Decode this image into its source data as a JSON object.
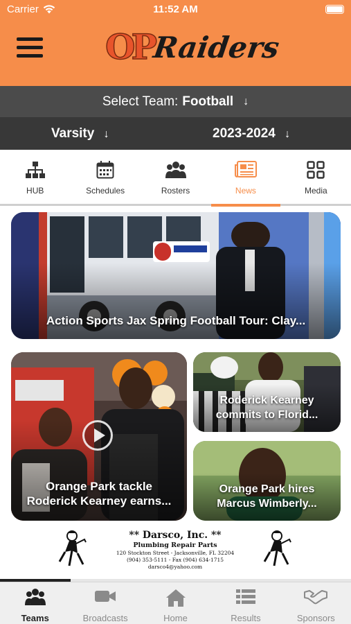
{
  "status_bar": {
    "carrier": "Carrier",
    "time": "11:52 AM"
  },
  "header": {
    "logo_initials": "OP",
    "logo_name": "Raiders",
    "brand_color": "#f68d4a"
  },
  "team_selector": {
    "label": "Select Team:",
    "value": "Football"
  },
  "level_selector": {
    "value": "Varsity"
  },
  "season_selector": {
    "value": "2023-2024"
  },
  "tabs": [
    {
      "label": "HUB",
      "icon": "sitemap-icon"
    },
    {
      "label": "Schedules",
      "icon": "calendar-icon"
    },
    {
      "label": "Rosters",
      "icon": "people-icon"
    },
    {
      "label": "News",
      "icon": "newspaper-icon",
      "active": true
    },
    {
      "label": "Media",
      "icon": "grid-icon"
    }
  ],
  "news": [
    {
      "caption": "Action Sports Jax Spring Football Tour: Clay..."
    },
    {
      "caption_line1": "Orange Park tackle",
      "caption_line2": "Roderick Kearney earns..."
    },
    {
      "caption_line1": "Roderick Kearney",
      "caption_line2": "commits to Florid..."
    },
    {
      "caption_line1": "Orange Park hires",
      "caption_line2": "Marcus Wimberly..."
    }
  ],
  "sponsor_ad": {
    "title": "** Darsco, Inc. **",
    "subtitle": "Plumbing Repair Parts",
    "address": "120 Stockton Street - Jacksonville, FL 32204",
    "phone": "(904) 353-5111  -  Fax (904) 634-1715",
    "email": "darsco4@yahoo.com"
  },
  "bottom_nav": [
    {
      "label": "Teams",
      "icon": "people-icon",
      "active": true
    },
    {
      "label": "Broadcasts",
      "icon": "video-camera-icon"
    },
    {
      "label": "Home",
      "icon": "home-icon"
    },
    {
      "label": "Results",
      "icon": "list-icon"
    },
    {
      "label": "Sponsors",
      "icon": "handshake-icon"
    }
  ]
}
